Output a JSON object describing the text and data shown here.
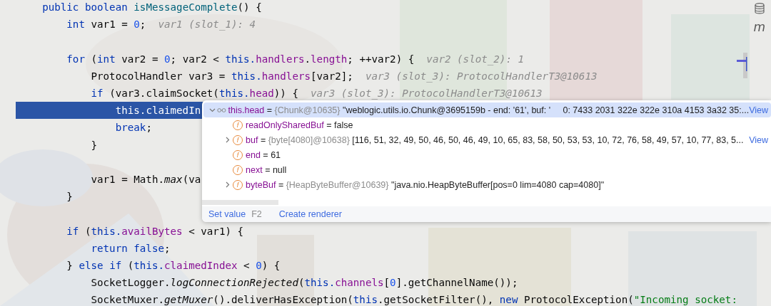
{
  "editor": {
    "lines": [
      {
        "selected": false,
        "tokens": [
          {
            "kind": "keyword",
            "text": "    public boolean "
          },
          {
            "kind": "method_decl",
            "text": "isMessageComplete"
          },
          {
            "kind": "plain",
            "text": "() {"
          }
        ]
      },
      {
        "selected": false,
        "tokens": [
          {
            "kind": "keyword",
            "text": "        int"
          },
          {
            "kind": "plain",
            "text": " var1 = "
          },
          {
            "kind": "number",
            "text": "0"
          },
          {
            "kind": "plain",
            "text": ";"
          }
        ],
        "hint": "var1 (slot_1): 4"
      },
      {
        "selected": false
      },
      {
        "selected": false,
        "tokens": [
          {
            "kind": "keyword",
            "text": "        for"
          },
          {
            "kind": "plain",
            "text": " ("
          },
          {
            "kind": "keyword",
            "text": "int"
          },
          {
            "kind": "plain",
            "text": " var2 = "
          },
          {
            "kind": "number",
            "text": "0"
          },
          {
            "kind": "plain",
            "text": "; var2 < "
          },
          {
            "kind": "keyword",
            "text": "this."
          },
          {
            "kind": "field",
            "text": "handlers"
          },
          {
            "kind": "plain",
            "text": "."
          },
          {
            "kind": "field",
            "text": "length"
          },
          {
            "kind": "plain",
            "text": "; ++var2) {"
          }
        ],
        "hint": "var2 (slot_2): 1"
      },
      {
        "selected": false,
        "tokens": [
          {
            "kind": "plain",
            "text": "            ProtocolHandler var3 = "
          },
          {
            "kind": "keyword",
            "text": "this."
          },
          {
            "kind": "field",
            "text": "handlers"
          },
          {
            "kind": "plain",
            "text": "[var2];"
          }
        ],
        "hint": "var3 (slot_3): ProtocolHandlerT3@10613"
      },
      {
        "selected": false,
        "tokens": [
          {
            "kind": "keyword",
            "text": "            if"
          },
          {
            "kind": "plain",
            "text": " (var3.claimSocket("
          },
          {
            "kind": "keyword",
            "text": "this."
          },
          {
            "kind": "field",
            "text": "head"
          },
          {
            "kind": "plain",
            "text": ")) {"
          }
        ],
        "hint": "var3 (slot_3): ProtocolHandlerT3@10613"
      },
      {
        "selected": true,
        "tokens": [
          {
            "kind": "keyword",
            "text": "                this."
          },
          {
            "kind": "field",
            "text": "claimedIn"
          }
        ]
      },
      {
        "selected": false,
        "tokens": [
          {
            "kind": "keyword",
            "text": "                break"
          },
          {
            "kind": "plain",
            "text": ";"
          }
        ]
      },
      {
        "selected": false,
        "tokens": [
          {
            "kind": "plain",
            "text": "            }"
          }
        ]
      },
      {
        "selected": false
      },
      {
        "selected": false,
        "tokens": [
          {
            "kind": "plain",
            "text": "            var1 = Math."
          },
          {
            "kind": "static_method",
            "text": "max"
          },
          {
            "kind": "plain",
            "text": "(va"
          }
        ]
      },
      {
        "selected": false,
        "tokens": [
          {
            "kind": "plain",
            "text": "        }"
          }
        ]
      },
      {
        "selected": false
      },
      {
        "selected": false,
        "tokens": [
          {
            "kind": "keyword",
            "text": "        if"
          },
          {
            "kind": "plain",
            "text": " ("
          },
          {
            "kind": "keyword",
            "text": "this."
          },
          {
            "kind": "field",
            "text": "availBytes"
          },
          {
            "kind": "plain",
            "text": " < var1) {"
          }
        ]
      },
      {
        "selected": false,
        "tokens": [
          {
            "kind": "keyword",
            "text": "            return false"
          },
          {
            "kind": "plain",
            "text": ";"
          }
        ]
      },
      {
        "selected": false,
        "tokens": [
          {
            "kind": "plain",
            "text": "        } "
          },
          {
            "kind": "keyword",
            "text": "else if"
          },
          {
            "kind": "plain",
            "text": " ("
          },
          {
            "kind": "keyword",
            "text": "this."
          },
          {
            "kind": "field",
            "text": "claimedIndex"
          },
          {
            "kind": "plain",
            "text": " < "
          },
          {
            "kind": "number",
            "text": "0"
          },
          {
            "kind": "plain",
            "text": ") {"
          }
        ]
      },
      {
        "selected": false,
        "tokens": [
          {
            "kind": "plain",
            "text": "            SocketLogger."
          },
          {
            "kind": "static_method",
            "text": "logConnectionRejected"
          },
          {
            "kind": "plain",
            "text": "("
          },
          {
            "kind": "keyword",
            "text": "this."
          },
          {
            "kind": "field",
            "text": "channels"
          },
          {
            "kind": "plain",
            "text": "["
          },
          {
            "kind": "number",
            "text": "0"
          },
          {
            "kind": "plain",
            "text": "].getChannelName());"
          }
        ]
      },
      {
        "selected": false,
        "tokens": [
          {
            "kind": "plain",
            "text": "            SocketMuxer."
          },
          {
            "kind": "static_method",
            "text": "getMuxer"
          },
          {
            "kind": "plain",
            "text": "().deliverHasException("
          },
          {
            "kind": "keyword",
            "text": "this"
          },
          {
            "kind": "plain",
            "text": ".getSocketFilter(), "
          },
          {
            "kind": "keyword",
            "text": "new"
          },
          {
            "kind": "plain",
            "text": " ProtocolException("
          },
          {
            "kind": "string",
            "text": "\"Incoming socket:"
          }
        ]
      }
    ]
  },
  "tool_icons": [
    {
      "kind": "database"
    },
    {
      "kind": "letter",
      "text": "m"
    }
  ],
  "debug_popup": {
    "rows": [
      {
        "kind": "watch",
        "selected": true,
        "expanded": true,
        "name": "this.head",
        "separator": "=",
        "type": "{Chunk@10635}",
        "value": "\"weblogic.utils.io.Chunk@3695159b - end: '61', buf: '     0: 7433 2031 322e 322e 310a 4153 3a32 35:...",
        "link": "View",
        "children": [
          {
            "kind": "field",
            "badge": "f",
            "selected": false,
            "name": "readOnlySharedBuf",
            "separator": "=",
            "value": "false"
          },
          {
            "kind": "field",
            "badge": "f",
            "selected": false,
            "expanded": false,
            "name": "buf",
            "separator": "=",
            "type": "{byte[4080]@10638}",
            "value": "[116, 51, 32, 49, 50, 46, 50, 46, 49, 10, 65, 83, 58, 50, 53, 53, 10, 72, 76, 58, 49, 57, 10, 77, 83, 5...",
            "link": "View"
          },
          {
            "kind": "field",
            "badge": "f",
            "selected": false,
            "name": "end",
            "separator": "=",
            "value": "61"
          },
          {
            "kind": "field",
            "badge": "f",
            "selected": false,
            "name": "next",
            "separator": "=",
            "value": "null"
          },
          {
            "kind": "field",
            "badge": "f",
            "selected": false,
            "expanded": false,
            "name": "byteBuf",
            "separator": "=",
            "type": "{HeapByteBuffer@10639}",
            "value": "\"java.nio.HeapByteBuffer[pos=0 lim=4080 cap=4080]\""
          }
        ]
      }
    ],
    "actions": [
      {
        "kind": "link",
        "label": "Set value",
        "shortcut": "F2"
      },
      {
        "kind": "link",
        "label": "Create renderer"
      }
    ]
  }
}
